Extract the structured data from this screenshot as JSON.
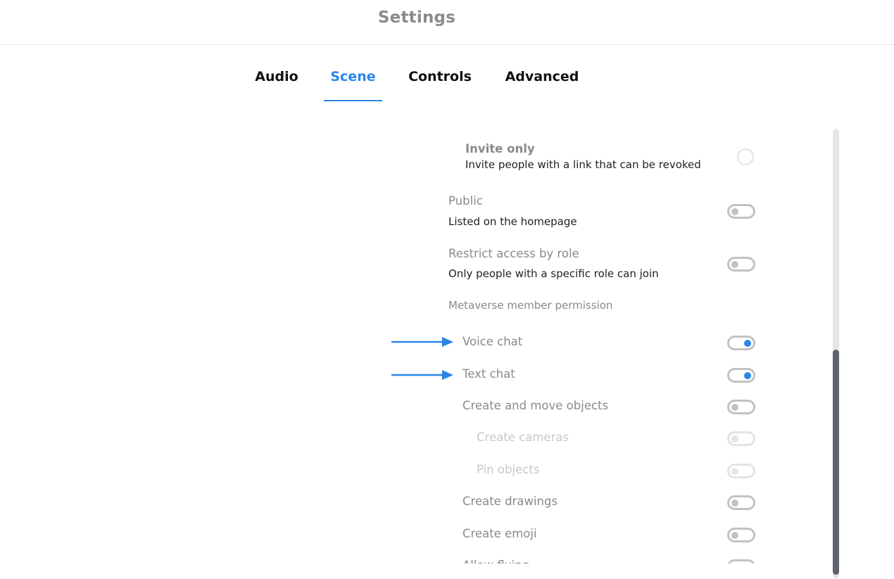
{
  "header": {
    "title": "Settings"
  },
  "tabs": [
    {
      "label": "Audio",
      "active": false
    },
    {
      "label": "Scene",
      "active": true
    },
    {
      "label": "Controls",
      "active": false
    },
    {
      "label": "Advanced",
      "active": false
    }
  ],
  "access": {
    "clipped_above": "",
    "invite_only": {
      "label": "Invite only",
      "description": "Invite people with a link that can be revoked",
      "selected": false
    },
    "public": {
      "label": "Public",
      "description": "Listed on the homepage",
      "enabled": false
    },
    "restrict_role": {
      "label": "Restrict access by role",
      "description": "Only people with a specific role can join",
      "enabled": false
    }
  },
  "permissions": {
    "section_label": "Metaverse member permission",
    "items": [
      {
        "label": "Voice chat",
        "enabled": true,
        "disabled": false,
        "highlighted": true
      },
      {
        "label": "Text chat",
        "enabled": true,
        "disabled": false,
        "highlighted": true
      },
      {
        "label": "Create and move objects",
        "enabled": false,
        "disabled": false
      },
      {
        "label": "Create cameras",
        "enabled": false,
        "disabled": true
      },
      {
        "label": "Pin objects",
        "enabled": false,
        "disabled": true
      },
      {
        "label": "Create drawings",
        "enabled": false,
        "disabled": false
      },
      {
        "label": "Create emoji",
        "enabled": false,
        "disabled": false
      },
      {
        "label": "Allow flying",
        "enabled": false,
        "disabled": false
      }
    ]
  },
  "colors": {
    "accent": "#2b86e8",
    "muted_text": "#8a8a8a",
    "toggle_border": "#c2c2c2",
    "scroll_thumb": "#5e646c"
  }
}
